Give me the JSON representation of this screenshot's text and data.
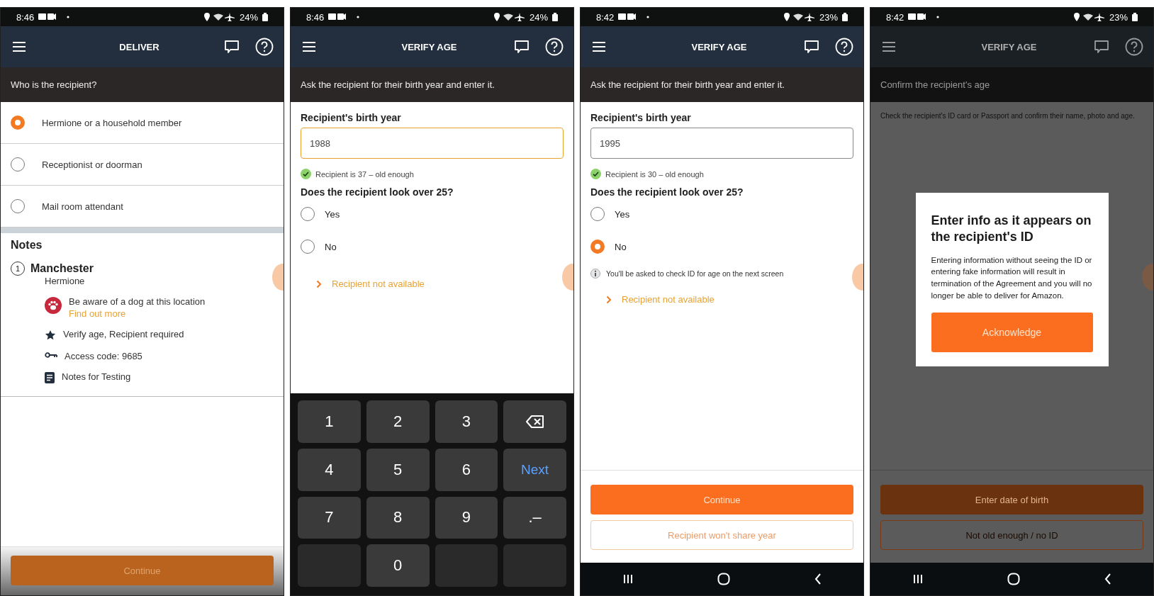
{
  "screens": [
    {
      "kind": "recipient_choice",
      "status_time": "8:46",
      "battery": "24%",
      "title": "DELIVER",
      "prompt": "Who is the recipient?",
      "nav_bar": false,
      "options": [
        {
          "label": "Hermione or a household member",
          "selected": true
        },
        {
          "label": "Receptionist or doorman",
          "selected": false
        },
        {
          "label": "Mail room attendant",
          "selected": false
        }
      ],
      "notes": {
        "heading": "Notes",
        "stop_number": "1",
        "stop_name": "Manchester",
        "customer": "Hermione",
        "items": [
          {
            "kind": "dog",
            "text": "Be aware of a dog at this location",
            "link": "Find out more"
          },
          {
            "kind": "star",
            "text": "Verify age, Recipient required"
          },
          {
            "kind": "key",
            "text": "Access code: 9685"
          },
          {
            "kind": "note",
            "text": "Notes for Testing"
          }
        ]
      },
      "buttons": [
        {
          "kind": "primary",
          "label": "Continue",
          "disabled": true
        }
      ]
    },
    {
      "kind": "birth_year",
      "status_time": "8:46",
      "battery": "24%",
      "title": "VERIFY AGE",
      "prompt": "Ask the recipient for their birth year and enter it.",
      "nav_bar": false,
      "field_label": "Recipient's birth year",
      "value": "1988",
      "focused": true,
      "result": "Recipient is 37 – old enough",
      "question": "Does the recipient look over 25?",
      "options": [
        {
          "label": "Yes",
          "selected": false
        },
        {
          "label": "No",
          "selected": false
        }
      ],
      "link": "Recipient not available",
      "keyboard": [
        {
          "kind": "digit",
          "label": "1"
        },
        {
          "kind": "digit",
          "label": "2"
        },
        {
          "kind": "digit",
          "label": "3"
        },
        {
          "kind": "backspace"
        },
        {
          "kind": "digit",
          "label": "4"
        },
        {
          "kind": "digit",
          "label": "5"
        },
        {
          "kind": "digit",
          "label": "6"
        },
        {
          "kind": "action",
          "label": "Next"
        },
        {
          "kind": "digit",
          "label": "7"
        },
        {
          "kind": "digit",
          "label": "8"
        },
        {
          "kind": "digit",
          "label": "9"
        },
        {
          "kind": "digit",
          "label": ".–"
        },
        {
          "kind": "blank"
        },
        {
          "kind": "digit",
          "label": "0"
        },
        {
          "kind": "blank"
        },
        {
          "kind": "blank"
        }
      ]
    },
    {
      "kind": "birth_year",
      "status_time": "8:42",
      "battery": "23%",
      "title": "VERIFY AGE",
      "prompt": "Ask the recipient for their birth year and enter it.",
      "nav_bar": true,
      "field_label": "Recipient's birth year",
      "value": "1995",
      "focused": false,
      "result": "Recipient is 30 – old enough",
      "question": "Does the recipient look over 25?",
      "options": [
        {
          "label": "Yes",
          "selected": false
        },
        {
          "label": "No",
          "selected": true
        }
      ],
      "info": "You'll be asked to check ID for age on the next screen",
      "link": "Recipient not available",
      "buttons": [
        {
          "kind": "primary",
          "label": "Continue",
          "disabled": false
        },
        {
          "kind": "outline",
          "label": "Recipient won't share year"
        }
      ]
    },
    {
      "kind": "id_check",
      "status_time": "8:42",
      "battery": "23%",
      "title": "VERIFY AGE",
      "prompt": "Confirm the recipient's age",
      "nav_bar": true,
      "body": "Check the recipient's ID card or Passport and confirm their name, photo and age.",
      "buttons": [
        {
          "kind": "primary",
          "label": "Enter date of birth",
          "disabled": false
        },
        {
          "kind": "outline",
          "label": "Not old enough / no ID"
        }
      ],
      "dialog": {
        "title": "Enter info as it appears on the recipient's ID",
        "text": "Entering information without seeing the ID or entering fake information will result in termination of the Agreement and you will no longer be able to deliver for Amazon.",
        "button": "Acknowledge"
      }
    }
  ]
}
